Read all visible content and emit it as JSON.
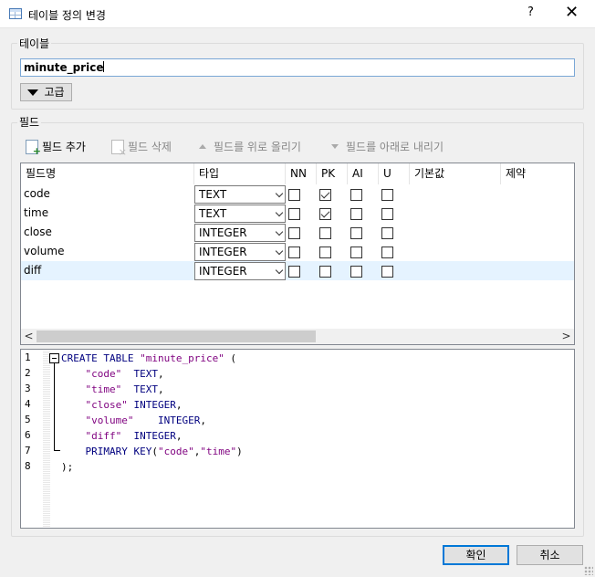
{
  "window": {
    "title": "테이블 정의 변경",
    "help": "?",
    "close": "✕"
  },
  "table_group": {
    "label": "테이블",
    "name_value": "minute_price",
    "advanced_label": "고급"
  },
  "fields_group": {
    "label": "필드"
  },
  "toolbar": {
    "add": "필드 추가",
    "remove": "필드 삭제",
    "move_up": "필드를 위로 올리기",
    "move_down": "필드를 아래로 내리기"
  },
  "columns": [
    "필드명",
    "타입",
    "NN",
    "PK",
    "AI",
    "U",
    "기본값",
    "제약"
  ],
  "fields": [
    {
      "name": "code",
      "type": "TEXT",
      "nn": false,
      "pk": true,
      "ai": false,
      "u": false
    },
    {
      "name": "time",
      "type": "TEXT",
      "nn": false,
      "pk": true,
      "ai": false,
      "u": false
    },
    {
      "name": "close",
      "type": "INTEGER",
      "nn": false,
      "pk": false,
      "ai": false,
      "u": false
    },
    {
      "name": "volume",
      "type": "INTEGER",
      "nn": false,
      "pk": false,
      "ai": false,
      "u": false
    },
    {
      "name": "diff",
      "type": "INTEGER",
      "nn": false,
      "pk": false,
      "ai": false,
      "u": false
    }
  ],
  "scroll": {
    "left": "<",
    "right": ">"
  },
  "sql_lines": [
    {
      "num": "1",
      "parts": [
        [
          "kw",
          "CREATE TABLE "
        ],
        [
          "str",
          "\"minute_price\""
        ],
        [
          "",
          " ("
        ]
      ]
    },
    {
      "num": "2",
      "parts": [
        [
          "",
          "    "
        ],
        [
          "str",
          "\"code\""
        ],
        [
          "",
          "  "
        ],
        [
          "kw",
          "TEXT"
        ],
        [
          "",
          ","
        ]
      ]
    },
    {
      "num": "3",
      "parts": [
        [
          "",
          "    "
        ],
        [
          "str",
          "\"time\""
        ],
        [
          "",
          "  "
        ],
        [
          "kw",
          "TEXT"
        ],
        [
          "",
          ","
        ]
      ]
    },
    {
      "num": "4",
      "parts": [
        [
          "",
          "    "
        ],
        [
          "str",
          "\"close\""
        ],
        [
          "",
          " "
        ],
        [
          "kw",
          "INTEGER"
        ],
        [
          "",
          ","
        ]
      ]
    },
    {
      "num": "5",
      "parts": [
        [
          "",
          "    "
        ],
        [
          "str",
          "\"volume\""
        ],
        [
          "",
          "    "
        ],
        [
          "kw",
          "INTEGER"
        ],
        [
          "",
          ","
        ]
      ]
    },
    {
      "num": "6",
      "parts": [
        [
          "",
          "    "
        ],
        [
          "str",
          "\"diff\""
        ],
        [
          "",
          "  "
        ],
        [
          "kw",
          "INTEGER"
        ],
        [
          "",
          ","
        ]
      ]
    },
    {
      "num": "7",
      "parts": [
        [
          "",
          "    "
        ],
        [
          "kw",
          "PRIMARY KEY"
        ],
        [
          "",
          "("
        ],
        [
          "str",
          "\"code\""
        ],
        [
          "",
          ","
        ],
        [
          "str",
          "\"time\""
        ],
        [
          "",
          ")"
        ]
      ]
    },
    {
      "num": "8",
      "parts": [
        [
          "",
          ");"
        ]
      ]
    }
  ],
  "buttons": {
    "ok": "확인",
    "cancel": "취소"
  }
}
